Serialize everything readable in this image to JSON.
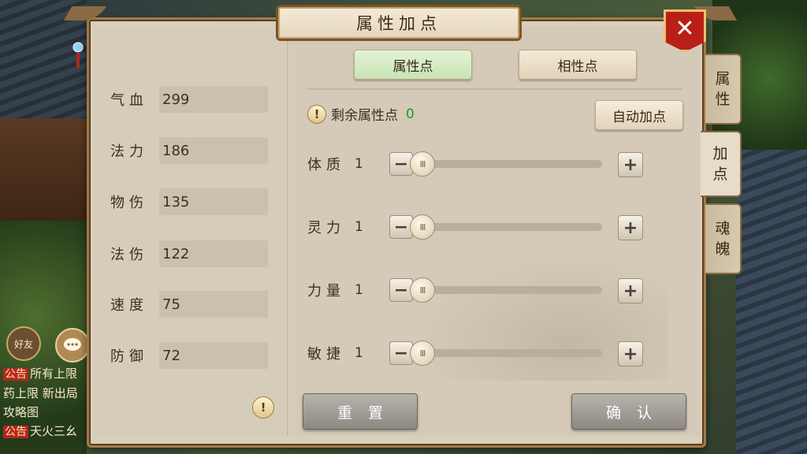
{
  "title": "属性加点",
  "close_glyph": "✕",
  "tabs": {
    "attr_points": "属性点",
    "phase_points": "相性点"
  },
  "side_tabs": [
    {
      "label_1": "属",
      "label_2": "性",
      "active": false
    },
    {
      "label_1": "加",
      "label_2": "点",
      "active": true
    },
    {
      "label_1": "魂",
      "label_2": "魄",
      "active": false
    }
  ],
  "stats": [
    {
      "label": "气血",
      "value": "299"
    },
    {
      "label": "法力",
      "value": "186"
    },
    {
      "label": "物伤",
      "value": "135"
    },
    {
      "label": "法伤",
      "value": "122"
    },
    {
      "label": "速度",
      "value": "75"
    },
    {
      "label": "防御",
      "value": "72"
    }
  ],
  "remaining": {
    "label": "剩余属性点",
    "value": "0"
  },
  "auto_button": "自动加点",
  "sliders": [
    {
      "label": "体质",
      "value": "1",
      "level": 0
    },
    {
      "label": "灵力",
      "value": "1",
      "level": 0
    },
    {
      "label": "力量",
      "value": "1",
      "level": 0
    },
    {
      "label": "敏捷",
      "value": "1",
      "level": 0
    }
  ],
  "slider_minus_glyph": "−",
  "slider_plus_glyph": "+",
  "slider_knob_glyph": "III",
  "info_glyph": "!",
  "buttons": {
    "reset": "重置",
    "confirm": "确认"
  },
  "hud": {
    "friend_label": "好友",
    "chat_lines": [
      {
        "tag": "公告",
        "text": "所有上限"
      },
      {
        "tag": "",
        "text": "药上限 新出局"
      },
      {
        "tag": "",
        "text": "攻略图"
      },
      {
        "tag": "公告",
        "text": "天火三幺"
      }
    ]
  },
  "colors": {
    "accent_green": "#1f9a2a",
    "close_red": "#b91f16",
    "panel_bg": "#d9cfbd",
    "frame_brown": "#7a5428"
  }
}
